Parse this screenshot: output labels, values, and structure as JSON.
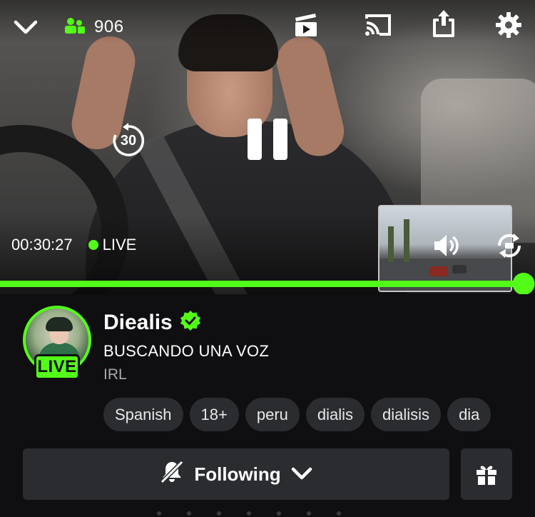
{
  "player": {
    "viewer_count": "906",
    "elapsed_time": "00:30:27",
    "live_label": "LIVE",
    "rewind_seconds": "30",
    "progress": 0.978,
    "icons": {
      "collapse": "chevron-down-icon",
      "viewers": "viewers-icon",
      "clip": "clip-icon",
      "cast": "cast-icon",
      "share": "share-icon",
      "settings": "gear-icon",
      "rewind": "rewind-30-icon",
      "pause": "pause-icon",
      "volume": "volume-icon",
      "swap": "swap-camera-icon"
    }
  },
  "channel": {
    "name": "Diealis",
    "verified_icon": "verified-badge-icon",
    "live_badge": "LIVE",
    "title": "BUSCANDO UNA VOZ",
    "category": "IRL",
    "tags": [
      "Spanish",
      "18+",
      "peru",
      "dialis",
      "dialisis",
      "dia"
    ]
  },
  "actions": {
    "follow_label": "Following",
    "follow_icon": "bell-off-icon",
    "follow_chevron": "chevron-down-icon",
    "gift_icon": "gift-icon"
  },
  "colors": {
    "accent": "#53fc18",
    "background": "#0f0f12",
    "surface": "#2b2c30",
    "muted_text": "#a9a9ae"
  }
}
